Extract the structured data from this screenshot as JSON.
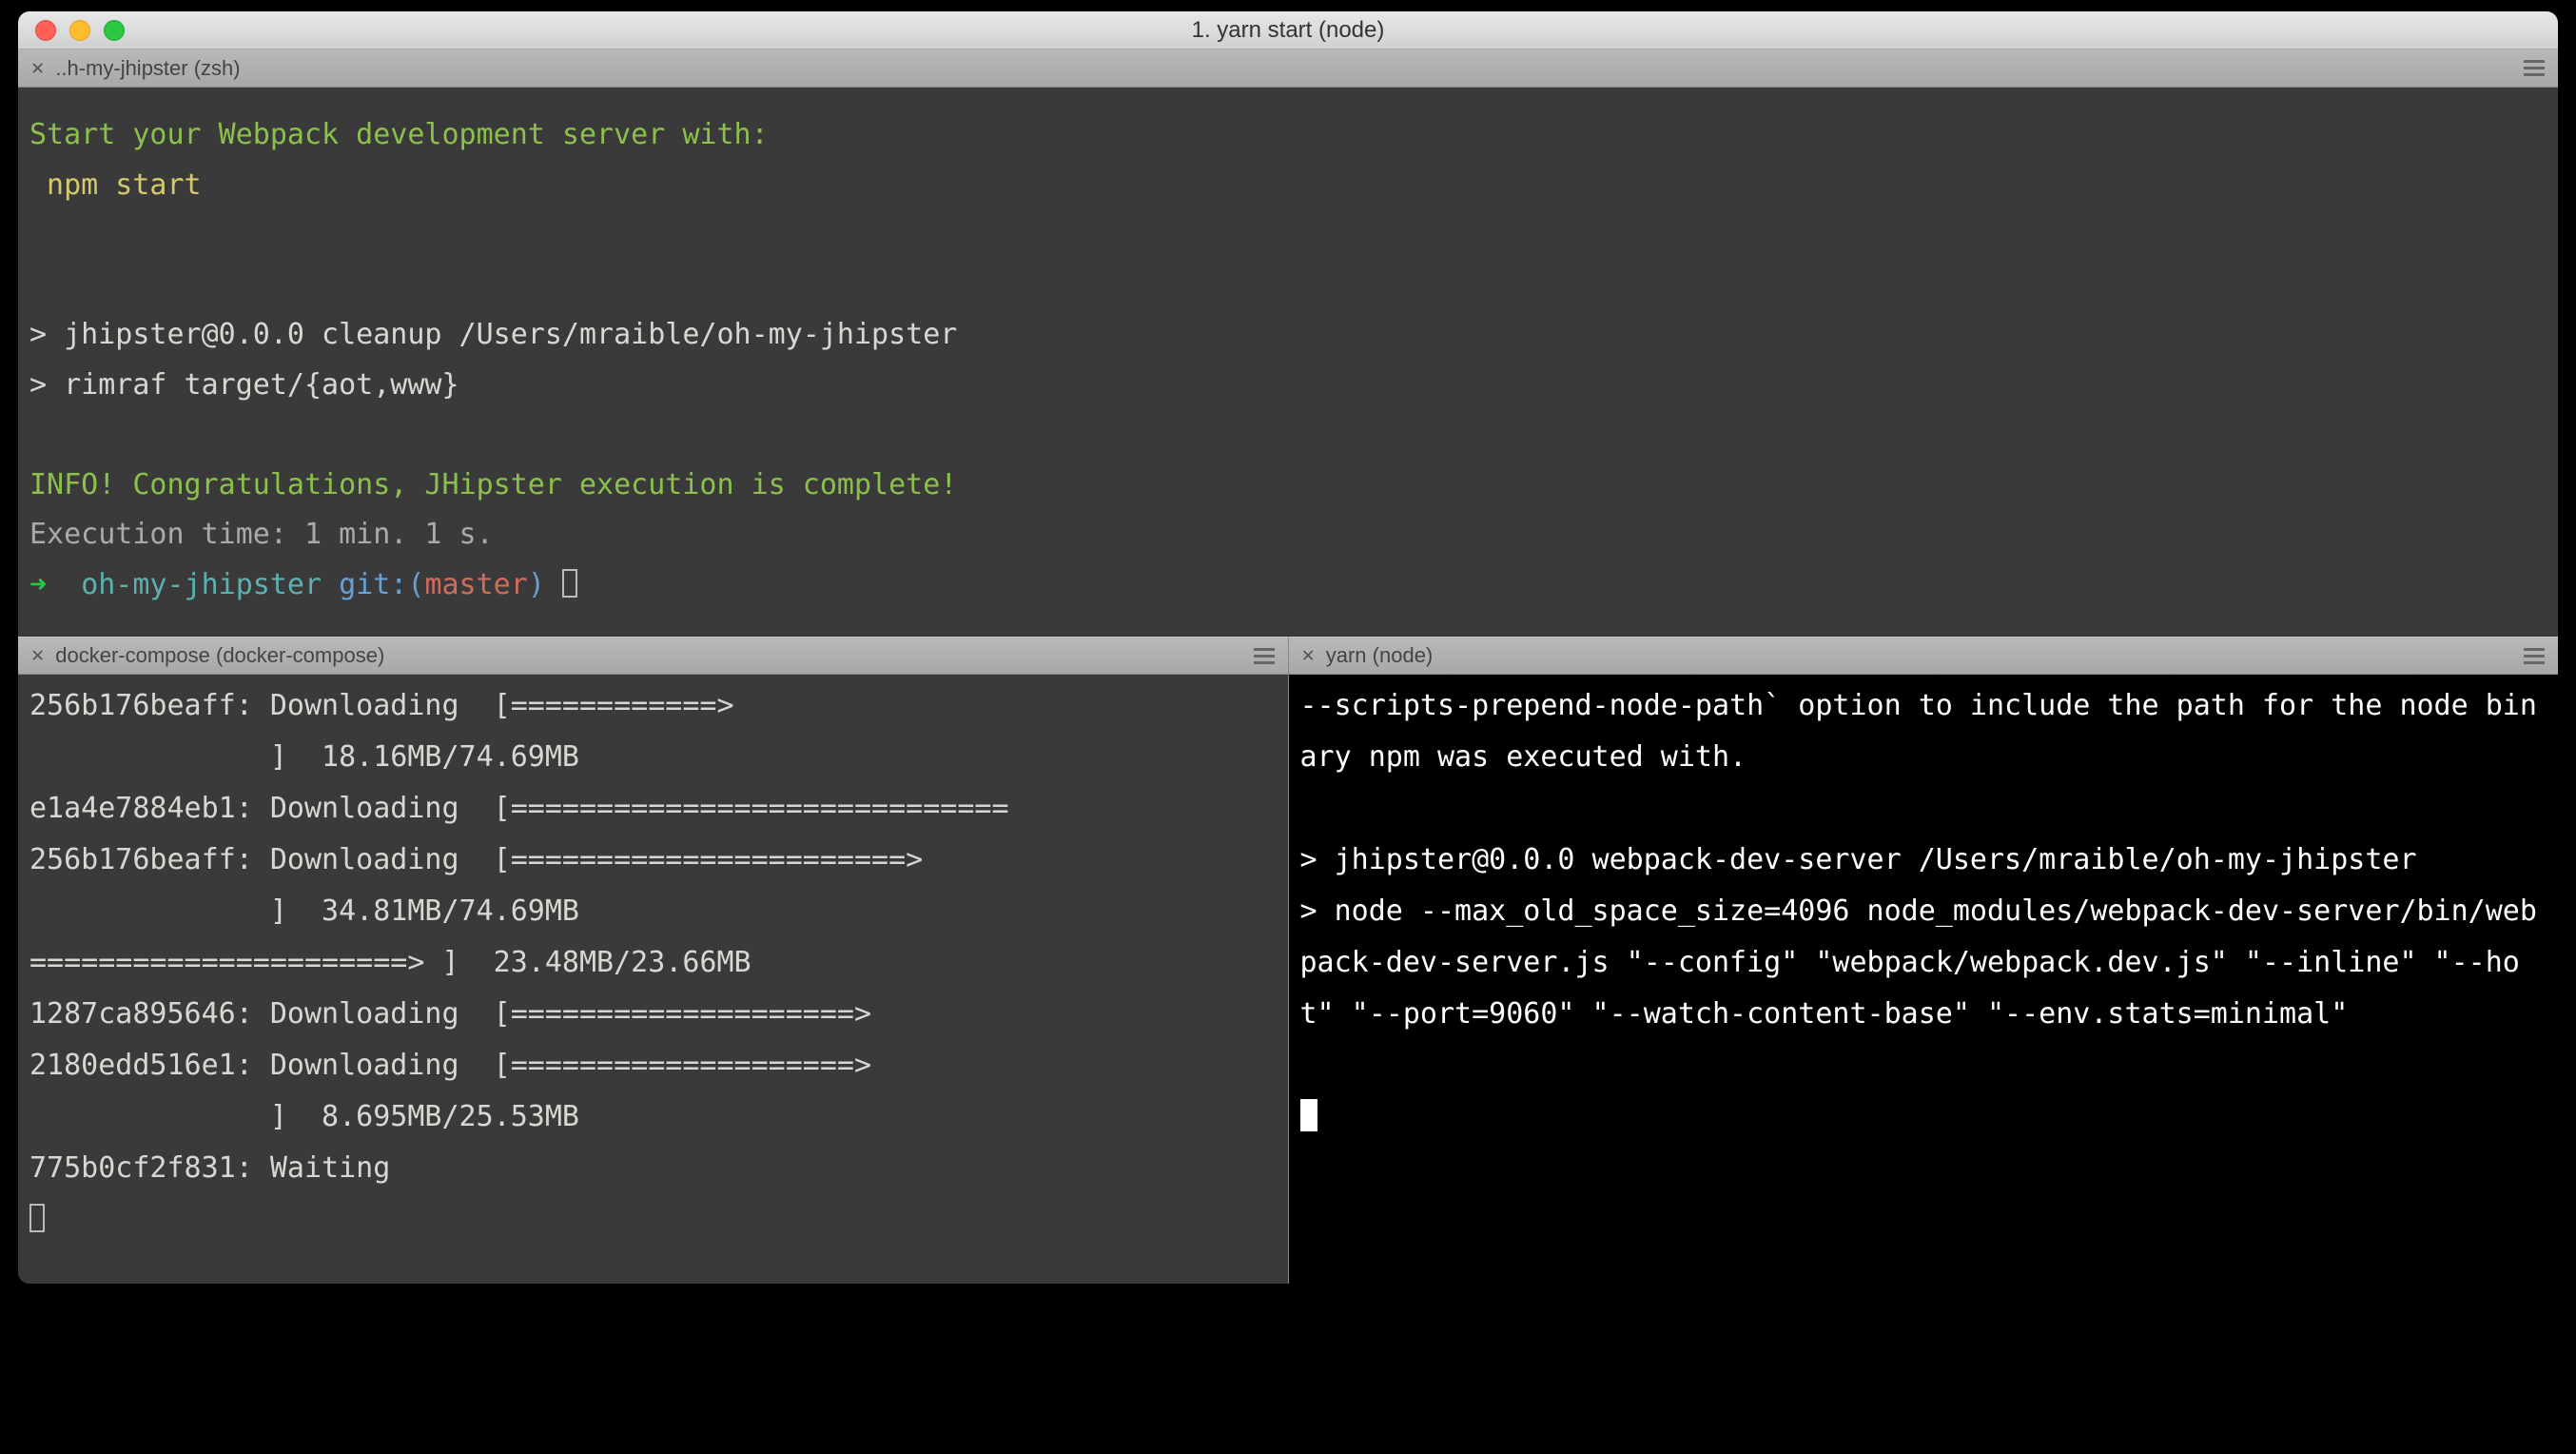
{
  "window": {
    "title": "1. yarn start (node)"
  },
  "tab_top": {
    "label": "..h-my-jhipster (zsh)"
  },
  "pane_top": {
    "line1": "Start your Webpack development server with:",
    "line2": " npm start",
    "line3": "",
    "line4": "",
    "line5": "> jhipster@0.0.0 cleanup /Users/mraible/oh-my-jhipster",
    "line6": "> rimraf target/{aot,www}",
    "line7": "",
    "line8": "INFO! Congratulations, JHipster execution is complete!",
    "line9_prefix": "Execution time: ",
    "line9_value": "1 min. 1 s.",
    "prompt_arrow": "➜",
    "prompt_dir": "oh-my-jhipster",
    "prompt_git": "git:(",
    "prompt_branch": "master",
    "prompt_close": ")"
  },
  "pane_left": {
    "tab_label": "docker-compose (docker-compose)",
    "lines": [
      "256b176beaff: Downloading  [============>",
      "              ]  18.16MB/74.69MB",
      "e1a4e7884eb1: Downloading  [=============================",
      "256b176beaff: Downloading  [=======================>",
      "              ]  34.81MB/74.69MB",
      "======================> ]  23.48MB/23.66MB",
      "1287ca895646: Downloading  [====================>",
      "2180edd516e1: Downloading  [====================>",
      "              ]  8.695MB/25.53MB",
      "775b0cf2f831: Waiting"
    ]
  },
  "pane_right": {
    "tab_label": "yarn (node)",
    "text": "--scripts-prepend-node-path` option to include the path for the node binary npm was executed with.\n\n> jhipster@0.0.0 webpack-dev-server /Users/mraible/oh-my-jhipster\n> node --max_old_space_size=4096 node_modules/webpack-dev-server/bin/webpack-dev-server.js \"--config\" \"webpack/webpack.dev.js\" \"--inline\" \"--hot\" \"--port=9060\" \"--watch-content-base\" \"--env.stats=minimal\"\n"
  }
}
